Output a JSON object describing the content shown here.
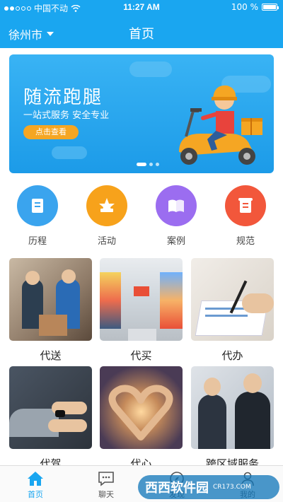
{
  "status_bar": {
    "carrier": "中国不动",
    "time": "11:27 AM",
    "battery": "100 %"
  },
  "header": {
    "city": "徐州市",
    "title": "首页"
  },
  "banner": {
    "headline": "随流跑腿",
    "subtitle": "一站式服务  安全专业",
    "cta": "点击查看"
  },
  "categories": [
    {
      "label": "历程",
      "icon": "document-icon",
      "color": "#3aa4ee"
    },
    {
      "label": "活动",
      "icon": "star-icon",
      "color": "#f7a21b"
    },
    {
      "label": "案例",
      "icon": "book-icon",
      "color": "#9b6df0"
    },
    {
      "label": "规范",
      "icon": "scroll-icon",
      "color": "#f2573b"
    }
  ],
  "services": [
    {
      "label": "代送"
    },
    {
      "label": "代买"
    },
    {
      "label": "代办"
    },
    {
      "label": "代驾"
    },
    {
      "label": "代心"
    },
    {
      "label": "跨区域服务"
    }
  ],
  "tabbar": {
    "items": [
      {
        "label": "首页",
        "icon": "home-icon"
      },
      {
        "label": "聊天",
        "icon": "chat-icon"
      },
      {
        "label": "发现",
        "icon": "compass-icon"
      },
      {
        "label": "我的",
        "icon": "user-icon"
      }
    ]
  },
  "watermark": {
    "brand": "西西软件园",
    "url": "CR173.COM"
  },
  "colors": {
    "primary": "#1aa6f0",
    "cta": "#f5a623"
  }
}
